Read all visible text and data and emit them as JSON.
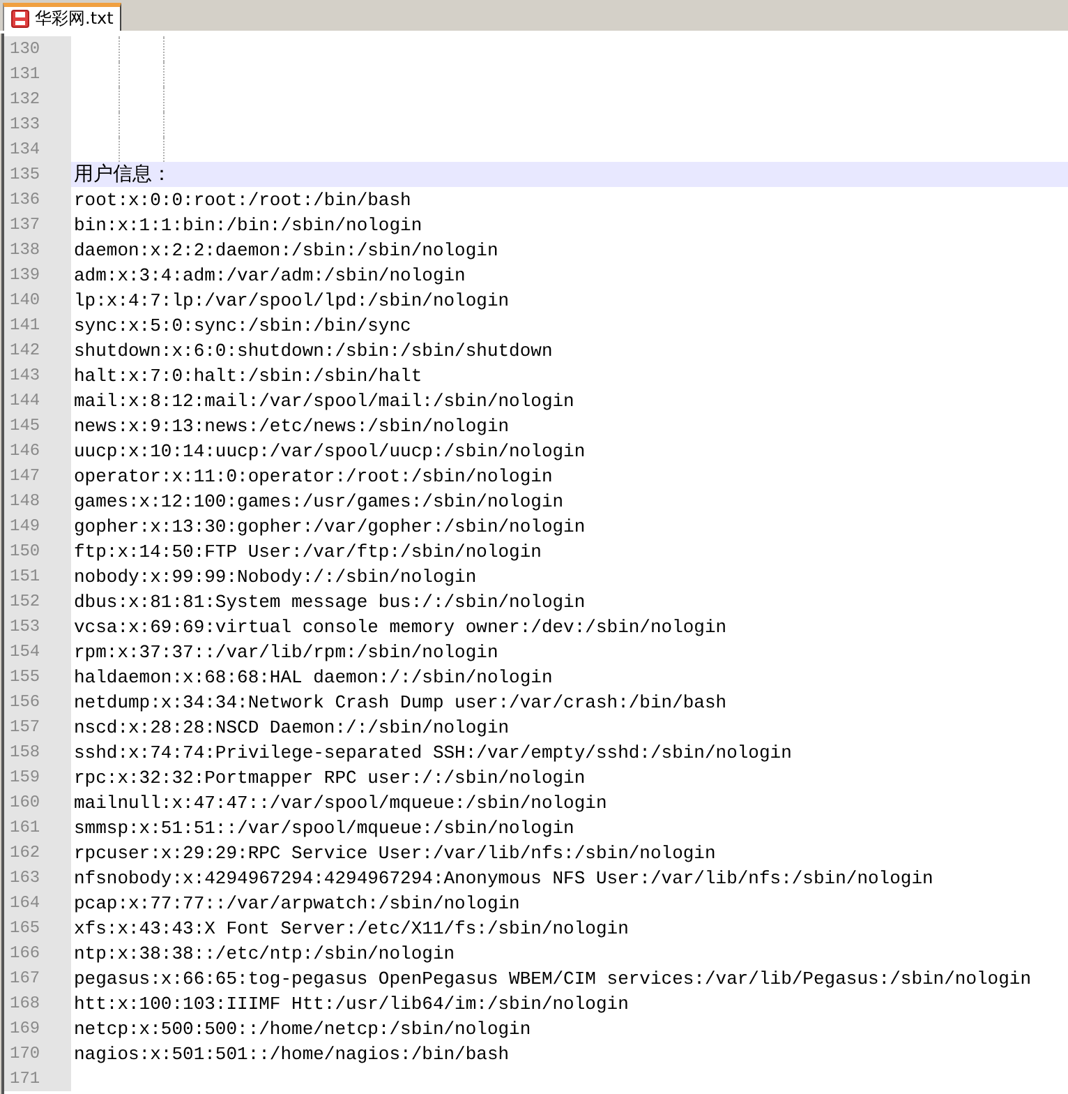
{
  "tabs": [
    {
      "label": "华彩网.txt",
      "selected": true
    }
  ],
  "lines": [
    {
      "number": "130",
      "current": false,
      "indent_guides": true
    },
    {
      "number": "131",
      "current": false,
      "indent_guides": true
    },
    {
      "number": "132",
      "current": false,
      "indent_guides": true
    },
    {
      "number": "133",
      "current": false,
      "indent_guides": true
    },
    {
      "number": "134",
      "current": false,
      "indent_guides": true
    },
    {
      "number": "135",
      "text": "用户信息：",
      "current": true
    },
    {
      "number": "136",
      "text": "root:x:0:0:root:/root:/bin/bash",
      "current": false
    },
    {
      "number": "137",
      "text": "bin:x:1:1:bin:/bin:/sbin/nologin",
      "current": false
    },
    {
      "number": "138",
      "text": "daemon:x:2:2:daemon:/sbin:/sbin/nologin",
      "current": false
    },
    {
      "number": "139",
      "text": "adm:x:3:4:adm:/var/adm:/sbin/nologin",
      "current": false
    },
    {
      "number": "140",
      "text": "lp:x:4:7:lp:/var/spool/lpd:/sbin/nologin",
      "current": false
    },
    {
      "number": "141",
      "text": "sync:x:5:0:sync:/sbin:/bin/sync",
      "current": false
    },
    {
      "number": "142",
      "text": "shutdown:x:6:0:shutdown:/sbin:/sbin/shutdown",
      "current": false
    },
    {
      "number": "143",
      "text": "halt:x:7:0:halt:/sbin:/sbin/halt",
      "current": false
    },
    {
      "number": "144",
      "text": "mail:x:8:12:mail:/var/spool/mail:/sbin/nologin",
      "current": false
    },
    {
      "number": "145",
      "text": "news:x:9:13:news:/etc/news:/sbin/nologin",
      "current": false
    },
    {
      "number": "146",
      "text": "uucp:x:10:14:uucp:/var/spool/uucp:/sbin/nologin",
      "current": false
    },
    {
      "number": "147",
      "text": "operator:x:11:0:operator:/root:/sbin/nologin",
      "current": false
    },
    {
      "number": "148",
      "text": "games:x:12:100:games:/usr/games:/sbin/nologin",
      "current": false
    },
    {
      "number": "149",
      "text": "gopher:x:13:30:gopher:/var/gopher:/sbin/nologin",
      "current": false
    },
    {
      "number": "150",
      "text": "ftp:x:14:50:FTP User:/var/ftp:/sbin/nologin",
      "current": false
    },
    {
      "number": "151",
      "text": "nobody:x:99:99:Nobody:/:/sbin/nologin",
      "current": false
    },
    {
      "number": "152",
      "text": "dbus:x:81:81:System message bus:/:/sbin/nologin",
      "current": false
    },
    {
      "number": "153",
      "text": "vcsa:x:69:69:virtual console memory owner:/dev:/sbin/nologin",
      "current": false
    },
    {
      "number": "154",
      "text": "rpm:x:37:37::/var/lib/rpm:/sbin/nologin",
      "current": false
    },
    {
      "number": "155",
      "text": "haldaemon:x:68:68:HAL daemon:/:/sbin/nologin",
      "current": false
    },
    {
      "number": "156",
      "text": "netdump:x:34:34:Network Crash Dump user:/var/crash:/bin/bash",
      "current": false
    },
    {
      "number": "157",
      "text": "nscd:x:28:28:NSCD Daemon:/:/sbin/nologin",
      "current": false
    },
    {
      "number": "158",
      "text": "sshd:x:74:74:Privilege-separated SSH:/var/empty/sshd:/sbin/nologin",
      "current": false
    },
    {
      "number": "159",
      "text": "rpc:x:32:32:Portmapper RPC user:/:/sbin/nologin",
      "current": false
    },
    {
      "number": "160",
      "text": "mailnull:x:47:47::/var/spool/mqueue:/sbin/nologin",
      "current": false
    },
    {
      "number": "161",
      "text": "smmsp:x:51:51::/var/spool/mqueue:/sbin/nologin",
      "current": false
    },
    {
      "number": "162",
      "text": "rpcuser:x:29:29:RPC Service User:/var/lib/nfs:/sbin/nologin",
      "current": false
    },
    {
      "number": "163",
      "text": "nfsnobody:x:4294967294:4294967294:Anonymous NFS User:/var/lib/nfs:/sbin/nologin",
      "current": false
    },
    {
      "number": "164",
      "text": "pcap:x:77:77::/var/arpwatch:/sbin/nologin",
      "current": false
    },
    {
      "number": "165",
      "text": "xfs:x:43:43:X Font Server:/etc/X11/fs:/sbin/nologin",
      "current": false
    },
    {
      "number": "166",
      "text": "ntp:x:38:38::/etc/ntp:/sbin/nologin",
      "current": false
    },
    {
      "number": "167",
      "text": "pegasus:x:66:65:tog-pegasus OpenPegasus WBEM/CIM services:/var/lib/Pegasus:/sbin/nologin",
      "current": false
    },
    {
      "number": "168",
      "text": "htt:x:100:103:IIIMF Htt:/usr/lib64/im:/sbin/nologin",
      "current": false
    },
    {
      "number": "169",
      "text": "netcp:x:500:500::/home/netcp:/sbin/nologin",
      "current": false
    },
    {
      "number": "170",
      "text": "nagios:x:501:501::/home/nagios:/bin/bash",
      "current": false
    },
    {
      "number": "171",
      "current": false
    }
  ]
}
